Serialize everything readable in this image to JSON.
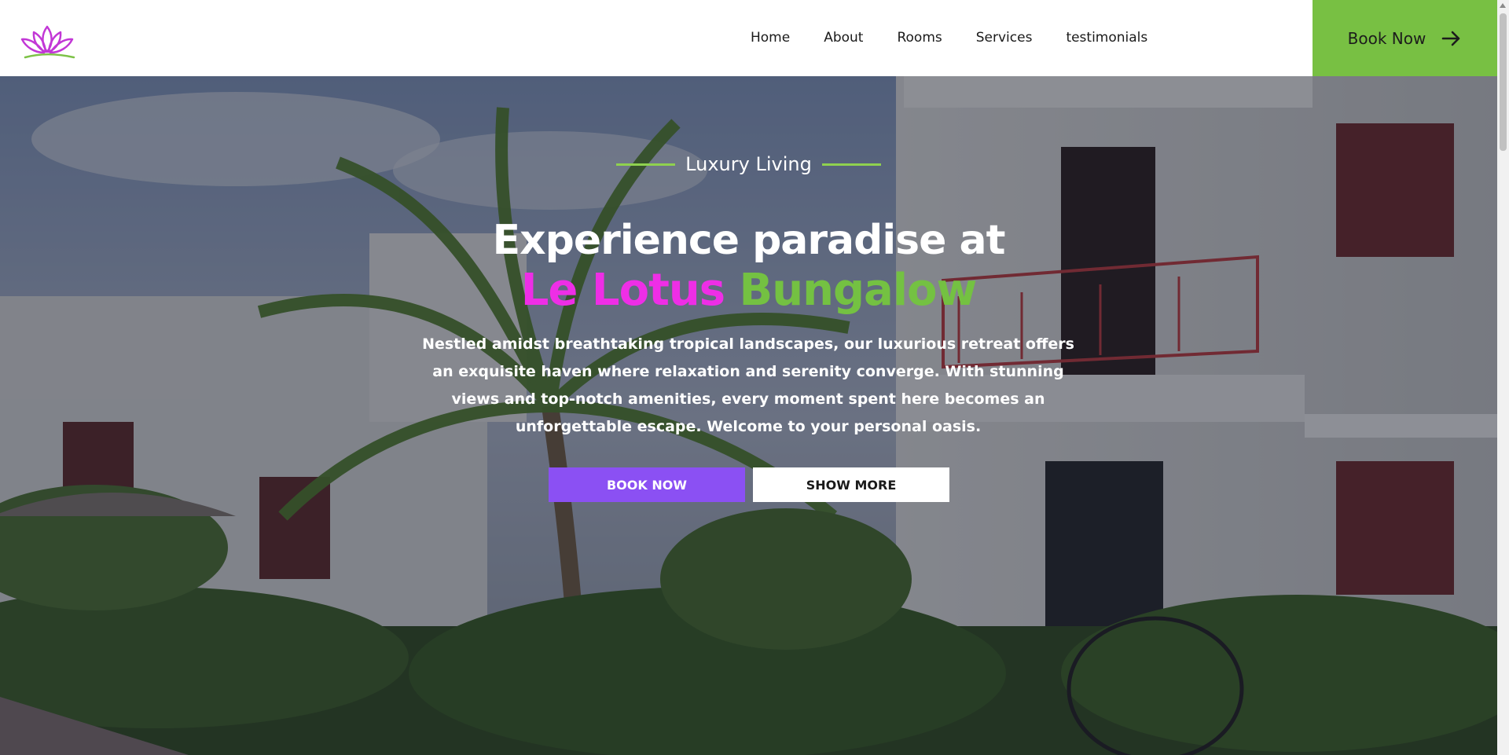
{
  "brand": {
    "logo_icon": "lotus-icon",
    "colors": {
      "pink": "#ee2ee6",
      "purple": "#8b50f3",
      "green": "#78c043"
    }
  },
  "nav": {
    "items": [
      {
        "label": "Home"
      },
      {
        "label": "About"
      },
      {
        "label": "Rooms"
      },
      {
        "label": "Services"
      },
      {
        "label": "testimonials"
      }
    ],
    "cta_label": "Book Now",
    "cta_icon": "arrow-right-icon"
  },
  "hero": {
    "eyebrow": "Luxury Living",
    "headline_line1": "Experience paradise at",
    "headline_pink": "Le Lotus",
    "headline_green": "Bungalow",
    "description": "Nestled amidst breathtaking tropical landscapes, our luxurious retreat offers an exquisite haven where relaxation and serenity converge. With stunning views and top-notch amenities, every moment spent here becomes an unforgettable escape. Welcome to your personal oasis.",
    "primary_button": "BOOK NOW",
    "secondary_button": "SHOW MORE"
  }
}
